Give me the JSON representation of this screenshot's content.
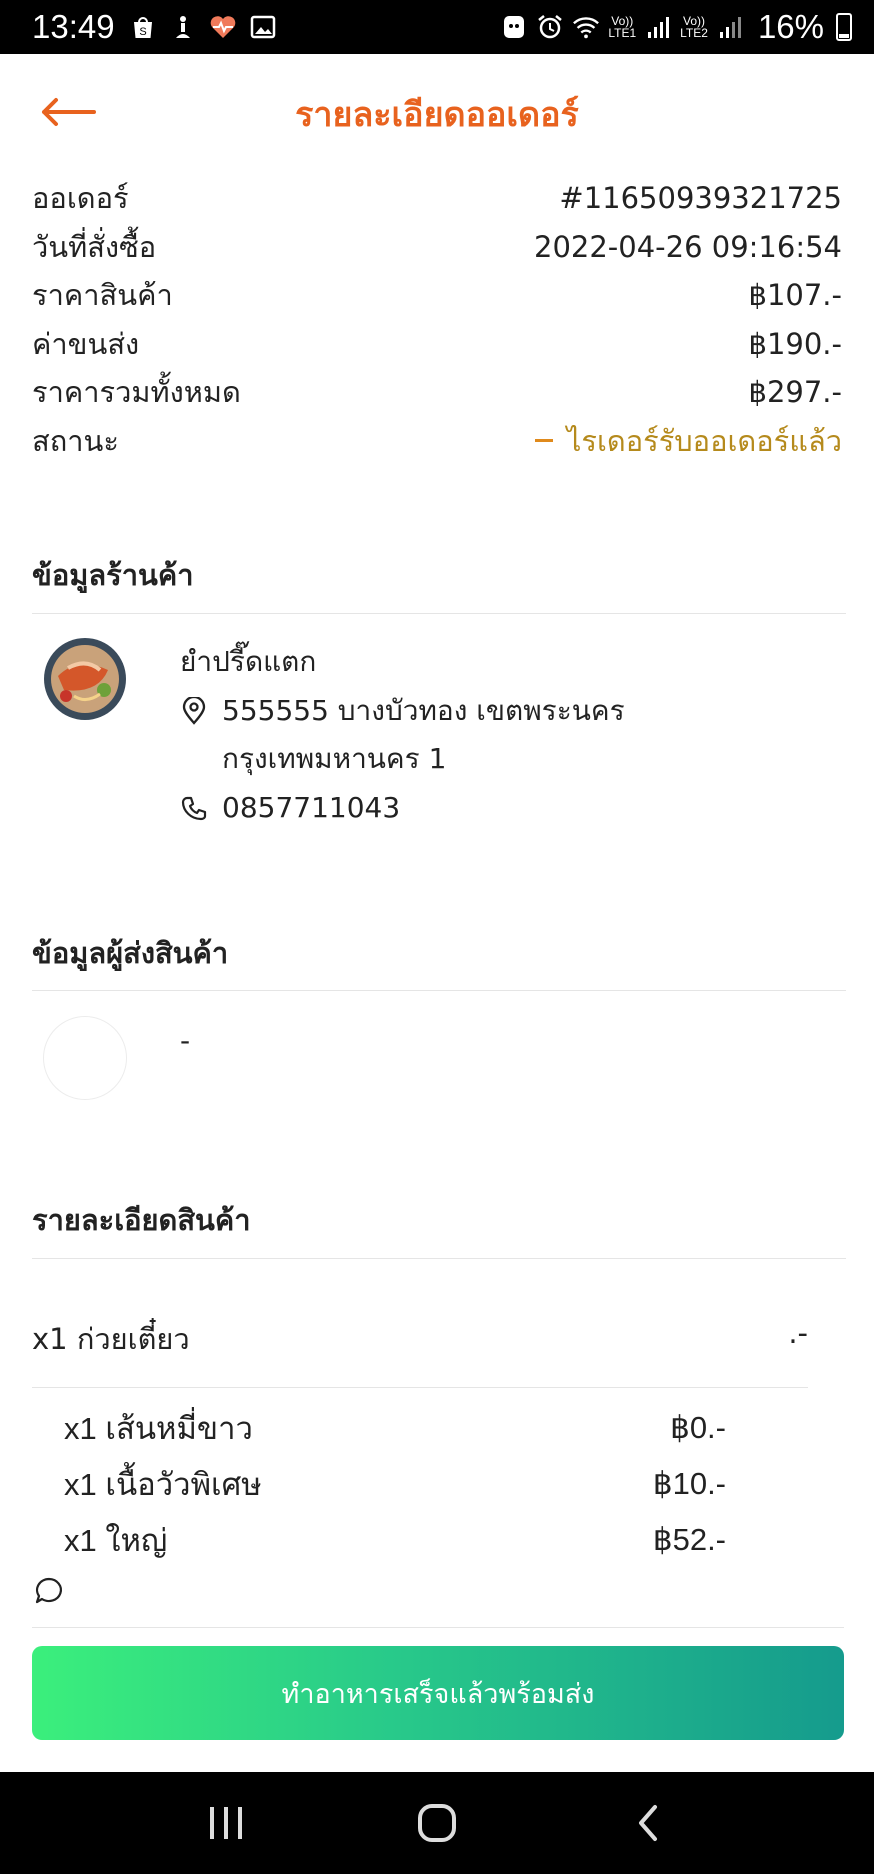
{
  "status_bar": {
    "time": "13:49",
    "left_icons": [
      "shopee-icon",
      "accessibility-icon",
      "heart-rate-icon",
      "image-icon"
    ],
    "right_icons": [
      "android-icon",
      "alarm-icon",
      "wifi-icon"
    ],
    "sim1_label_top": "Vo))",
    "sim1_label_bottom": "LTE1",
    "sim2_label_top": "Vo))",
    "sim2_label_bottom": "LTE2",
    "battery": "16%"
  },
  "header": {
    "title": "รายละเอียดออเดอร์",
    "back_icon": "arrow-left-icon",
    "accent_color": "#e8621e"
  },
  "summary": {
    "rows": [
      {
        "label": "ออเดอร์",
        "value": "#11650939321725"
      },
      {
        "label": "วันที่สั่งซื้อ",
        "value": "2022-04-26 09:16:54"
      },
      {
        "label": "ราคาสินค้า",
        "value": "฿107.-"
      },
      {
        "label": "ค่าขนส่ง",
        "value": "฿190.-"
      },
      {
        "label": "ราคารวมทั้งหมด",
        "value": "฿297.-"
      }
    ],
    "status_label": "สถานะ",
    "status_value": "ไรเดอร์รับออเดอร์แล้ว",
    "status_color": "#b58a1c"
  },
  "shop": {
    "section_title": "ข้อมูลร้านค้า",
    "name": "ยำปรี๊ดแตก",
    "address_line1": "555555 บางบัวทอง เขตพระนคร",
    "address_line2": "กรุงเทพมหานคร 1",
    "phone": "0857711043"
  },
  "rider": {
    "section_title": "ข้อมูลผู้ส่งสินค้า",
    "name": "-"
  },
  "items": {
    "section_title": "รายละเอียดสินค้า",
    "main": {
      "label": "x1 ก่วยเตี๋ยว",
      "price": ".-"
    },
    "options": [
      {
        "label": "x1 เส้นหมี่ขาว",
        "price": "฿0.-"
      },
      {
        "label": "x1 เนื้อวัวพิเศษ",
        "price": "฿10.-"
      },
      {
        "label": "x1 ใหญ่",
        "price": "฿52.-"
      }
    ]
  },
  "action": {
    "label": "ทำอาหารเสร็จแล้วพร้อมส่ง",
    "gradient": [
      "#3bef7c",
      "#159b8d"
    ]
  },
  "navbar": {
    "buttons": [
      "recent-apps-icon",
      "home-icon",
      "back-icon"
    ]
  }
}
